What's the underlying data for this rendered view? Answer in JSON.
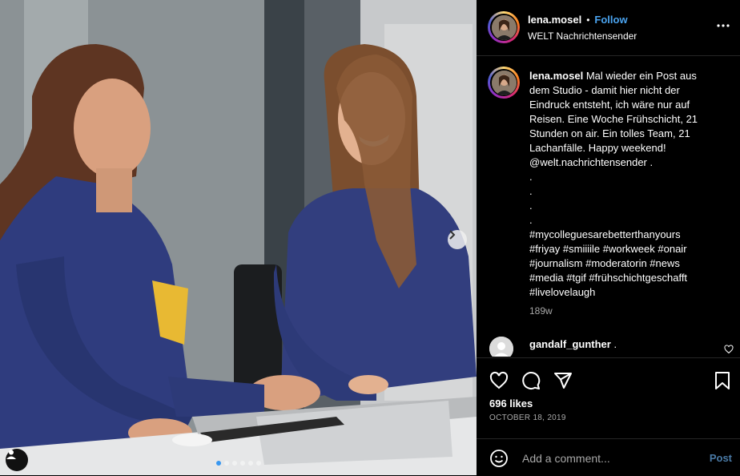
{
  "post": {
    "author": "lena.mosel",
    "follow_label": "Follow",
    "separator": "•",
    "location": "WELT Nachrichtensender",
    "caption_author": "lena.mosel",
    "caption_body": " Mal wieder ein Post aus dem Studio - damit hier nicht der Eindruck entsteht, ich wäre nur auf Reisen. Eine Woche Frühschicht, 21 Stunden on air. Ein tolles Team, 21 Lachanfälle. Happy weekend! @welt.nachrichtensender .\n.\n.\n.\n.\n#mycolleguesarebetterthanyours #friyay #smiiiile #workweek #onair #journalism #moderatorin #news #media #tgif #frühschichtgeschafft #livelovelaugh",
    "time_ago": "189w",
    "likes": "696 likes",
    "date": "OCTOBER 18, 2019"
  },
  "comments": [
    {
      "username": "gandalf_gunther",
      "text": " ."
    }
  ],
  "comment_box": {
    "placeholder": "Add a comment...",
    "post_label": "Post"
  },
  "carousel": {
    "slide_count": 6,
    "active_index": 0
  },
  "colors": {
    "accent": "#0095f6",
    "background": "#000000"
  }
}
